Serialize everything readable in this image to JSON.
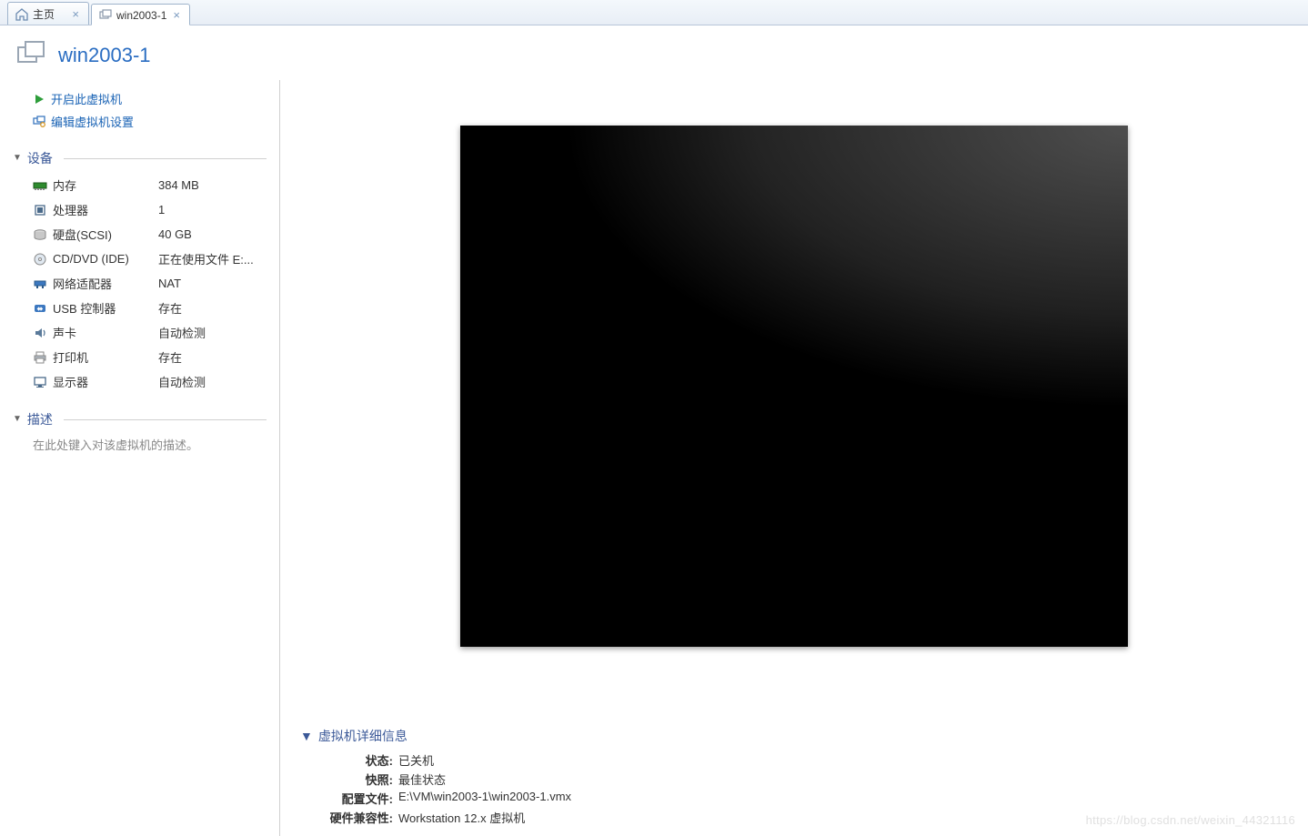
{
  "tabs": {
    "home": {
      "label": "主页"
    },
    "vm": {
      "label": "win2003-1"
    }
  },
  "header": {
    "title": "win2003-1"
  },
  "actions": {
    "power_on": "开启此虚拟机",
    "edit_settings": "编辑虚拟机设置"
  },
  "sections": {
    "devices": "设备",
    "description": "描述",
    "details": "虚拟机详细信息"
  },
  "devices": {
    "memory": {
      "label": "内存",
      "value": "384 MB"
    },
    "cpu": {
      "label": "处理器",
      "value": "1"
    },
    "disk": {
      "label": "硬盘(SCSI)",
      "value": "40 GB"
    },
    "cddvd": {
      "label": "CD/DVD (IDE)",
      "value": "正在使用文件 E:..."
    },
    "net": {
      "label": "网络适配器",
      "value": "NAT"
    },
    "usb": {
      "label": "USB 控制器",
      "value": "存在"
    },
    "sound": {
      "label": "声卡",
      "value": "自动检测"
    },
    "printer": {
      "label": "打印机",
      "value": "存在"
    },
    "display": {
      "label": "显示器",
      "value": "自动检测"
    }
  },
  "description": {
    "placeholder": "在此处键入对该虚拟机的描述。"
  },
  "details": {
    "state_k": "状态:",
    "state_v": "已关机",
    "snapshot_k": "快照:",
    "snapshot_v": "最佳状态",
    "config_k": "配置文件:",
    "config_v": "E:\\VM\\win2003-1\\win2003-1.vmx",
    "compat_k": "硬件兼容性:",
    "compat_v": "Workstation 12.x 虚拟机"
  },
  "watermark": "https://blog.csdn.net/weixin_44321116"
}
